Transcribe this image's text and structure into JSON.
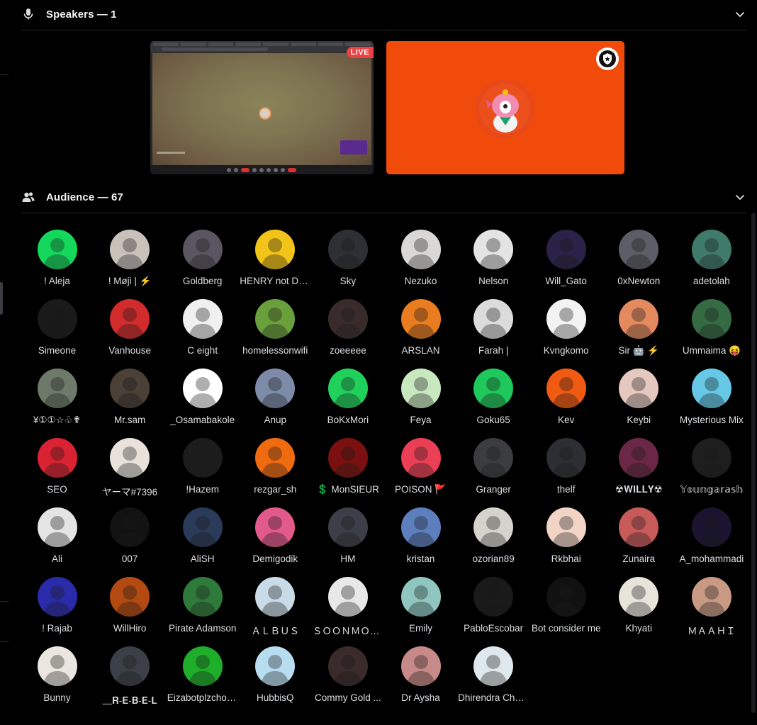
{
  "speakers": {
    "title": "Speakers — 1",
    "stream_badge": "LIVE"
  },
  "audience": {
    "title": "Audience — 67",
    "members": [
      {
        "name": "! Aleja",
        "color": "#14d85c",
        "icon": "avatar-masked"
      },
      {
        "name": "! Møji | ⚡",
        "color": "#c9c2bb",
        "icon": "avatar-character"
      },
      {
        "name": "Goldberg",
        "color": "#5a5560",
        "icon": "avatar-character"
      },
      {
        "name": "HENRY not DEAD",
        "color": "#f2c318",
        "icon": "avatar-motorbike"
      },
      {
        "name": "Sky",
        "color": "#2c2f33",
        "icon": "avatar-anime"
      },
      {
        "name": "Nezuko",
        "color": "#d9d8d6",
        "icon": "avatar-anime"
      },
      {
        "name": "Nelson",
        "color": "#e4e4e4",
        "icon": "avatar-sunglasses"
      },
      {
        "name": "Will_Gato",
        "color": "#2a2248",
        "icon": "avatar-hooded"
      },
      {
        "name": "0xNewton",
        "color": "#5b5e66",
        "icon": "avatar-character"
      },
      {
        "name": "adetolah",
        "color": "#3f7a6a",
        "icon": "avatar-character"
      },
      {
        "name": "Simeone",
        "color": "#1a1a1a",
        "icon": "avatar-character"
      },
      {
        "name": "Vanhouse",
        "color": "#d12b2b",
        "icon": "avatar-character"
      },
      {
        "name": "C eight",
        "color": "#f0f0f0",
        "icon": "avatar-sunglasses"
      },
      {
        "name": "homelessonwifi",
        "color": "#6aa03c",
        "icon": "avatar-character"
      },
      {
        "name": "zoeeeee",
        "color": "#3a2b2b",
        "icon": "avatar-photo"
      },
      {
        "name": "ARSLAN",
        "color": "#e87c1e",
        "icon": "avatar-character"
      },
      {
        "name": "Farah |",
        "color": "#dcdcdc",
        "icon": "avatar-character"
      },
      {
        "name": "Kvngkomo",
        "color": "#f3f3f3",
        "icon": "avatar-character"
      },
      {
        "name": "Sir 🤖 ⚡",
        "color": "#e48a5e",
        "icon": "avatar-character"
      },
      {
        "name": "Ummaima 😝",
        "color": "#356b42",
        "icon": "avatar-anime"
      },
      {
        "name": "¥①①☆♧✟",
        "color": "#6d7a6a",
        "icon": "avatar-anime"
      },
      {
        "name": "Mr.sam",
        "color": "#4a4036",
        "icon": "avatar-photo"
      },
      {
        "name": "_Osamabakole",
        "color": "#ffffff",
        "icon": "avatar-character"
      },
      {
        "name": "Anup",
        "color": "#7e8ba8",
        "icon": "avatar-anime"
      },
      {
        "name": "BoKxMori",
        "color": "#1fd15b",
        "icon": "avatar-silhouette"
      },
      {
        "name": "Feya",
        "color": "#c8e8c0",
        "icon": "avatar-character"
      },
      {
        "name": "Goku65",
        "color": "#1fc85a",
        "icon": "avatar-sunglasses"
      },
      {
        "name": "Kev",
        "color": "#f05a12",
        "icon": "avatar-character"
      },
      {
        "name": "Keybi",
        "color": "#e5c9c0",
        "icon": "avatar-photo"
      },
      {
        "name": "Mysterious Mix",
        "color": "#66c8e6",
        "icon": "avatar-character"
      },
      {
        "name": "SEO",
        "color": "#d92332",
        "icon": "avatar-character"
      },
      {
        "name": "ヤーマ#7396",
        "color": "#e8e2da",
        "icon": "avatar-anime"
      },
      {
        "name": "!Hazem",
        "color": "#1c1c1c",
        "icon": "avatar-photo"
      },
      {
        "name": "rezgar_sh",
        "color": "#f06a10",
        "icon": "avatar-character"
      },
      {
        "name": "💲 MonSIEUR",
        "color": "#7a1010",
        "icon": "avatar-hooded"
      },
      {
        "name": "POISON 🚩",
        "color": "#ea3f55",
        "icon": "avatar-character"
      },
      {
        "name": "Granger",
        "color": "#3a3c40",
        "icon": "avatar-photo"
      },
      {
        "name": "thelf",
        "color": "#2c2e33",
        "icon": "avatar-anime"
      },
      {
        "name": "☢𝐖𝐈𝐋𝐋𝐘☢",
        "color": "#6a2846",
        "icon": "avatar-character"
      },
      {
        "name": "𝕐𝕠𝕦𝕟𝕘𝕒𝕣𝕒𝕤𝕙",
        "color": "#1e1e1e",
        "icon": "avatar-hooded"
      },
      {
        "name": "Ali",
        "color": "#e4e4e4",
        "icon": "avatar-character"
      },
      {
        "name": "007",
        "color": "#121212",
        "icon": "avatar-character"
      },
      {
        "name": "AliSH",
        "color": "#2a3b5a",
        "icon": "avatar-character"
      },
      {
        "name": "Demigodik",
        "color": "#e25a8a",
        "icon": "avatar-character"
      },
      {
        "name": "HM",
        "color": "#3d3f48",
        "icon": "avatar-anime"
      },
      {
        "name": "kristan",
        "color": "#5d7fbe",
        "icon": "avatar-character"
      },
      {
        "name": "ozorian89",
        "color": "#d6d2cc",
        "icon": "avatar-anime"
      },
      {
        "name": "Rkbhai",
        "color": "#f2d4c6",
        "icon": "avatar-character"
      },
      {
        "name": "Zunaira",
        "color": "#c95a5a",
        "icon": "avatar-character"
      },
      {
        "name": "A_mohammadi",
        "color": "#1a1430",
        "icon": "avatar-character"
      },
      {
        "name": "! Rajab",
        "color": "#2a2ba8",
        "icon": "avatar-character"
      },
      {
        "name": "WillHiro",
        "color": "#b24a12",
        "icon": "avatar-photo"
      },
      {
        "name": "Pirate Adamson",
        "color": "#2e7a3a",
        "icon": "avatar-character"
      },
      {
        "name": "ＡＬＢＵＳ",
        "color": "#c8dbe6",
        "icon": "avatar-sunglasses"
      },
      {
        "name": "ＳＯＯＮＭＯＯＮ ⬢",
        "color": "#e8e8e8",
        "icon": "avatar-character"
      },
      {
        "name": "Emily",
        "color": "#8fc7c0",
        "icon": "avatar-character"
      },
      {
        "name": "PabloEscobar",
        "color": "#1a1a1a",
        "icon": "avatar-character"
      },
      {
        "name": "Bot consider me",
        "color": "#111111",
        "icon": "avatar-character"
      },
      {
        "name": "Khyati",
        "color": "#e8e4dc",
        "icon": "avatar-character"
      },
      {
        "name": "ＭＡＡＨＩ",
        "color": "#c89a84",
        "icon": "avatar-photo"
      },
      {
        "name": "Bunny",
        "color": "#ece6e0",
        "icon": "avatar-character"
      },
      {
        "name": "﹏𝐑-𝐄-𝐁-𝐄-𝐋",
        "color": "#3b4048",
        "icon": "avatar-character"
      },
      {
        "name": "Eizabotplzchooseme",
        "color": "#1fae2a",
        "icon": "avatar-alien"
      },
      {
        "name": "HubbisQ",
        "color": "#b8dcf0",
        "icon": "avatar-silhouette"
      },
      {
        "name": "Commy Gold ...",
        "color": "#3a2a2a",
        "icon": "avatar-character"
      },
      {
        "name": "Dr Aysha",
        "color": "#c78a88",
        "icon": "avatar-character"
      },
      {
        "name": "Dhirendra Chouhan",
        "color": "#dfe8ec",
        "icon": "avatar-anime"
      }
    ]
  }
}
